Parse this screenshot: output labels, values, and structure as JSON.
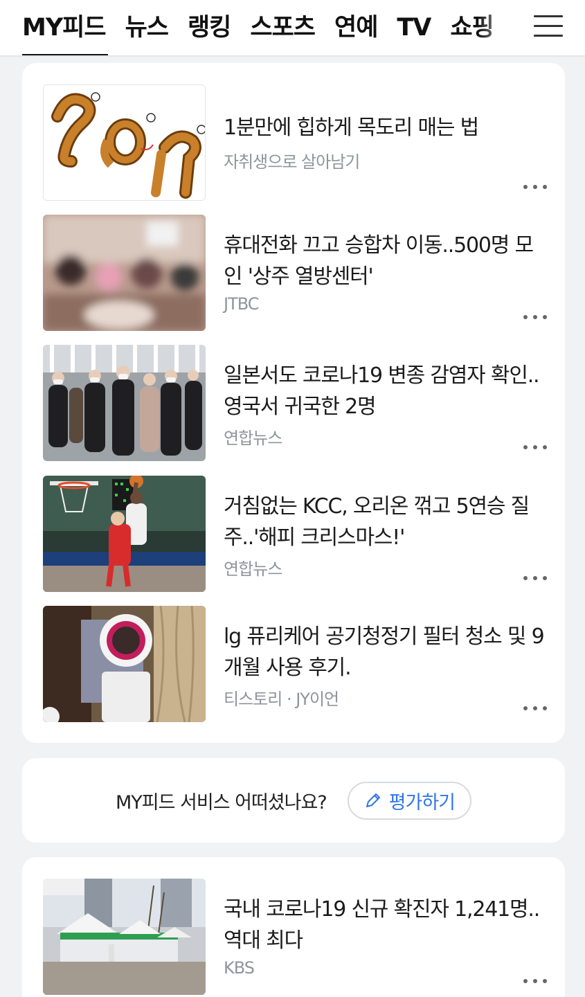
{
  "nav": {
    "tabs": [
      "MY피드",
      "뉴스",
      "랭킹",
      "스포츠",
      "연예",
      "TV",
      "쇼핑"
    ],
    "active_tab": "MY피드",
    "menu_icon": "hamburger-menu-icon"
  },
  "feed": [
    {
      "title": "1분만에 힙하게 목도리 매는 법",
      "source": "자취생으로 살아남기",
      "thumb": "scarf-tying-illustration"
    },
    {
      "title": "휴대전화 끄고 승합차 이동..500명 모인 '상주 열방센터'",
      "source": "JTBC",
      "thumb": "blurred-crowd-photo"
    },
    {
      "title": "일본서도 코로나19 변종 감염자 확인..영국서 귀국한 2명",
      "source": "연합뉴스",
      "thumb": "masked-commuters-photo"
    },
    {
      "title": "거침없는 KCC, 오리온 꺾고 5연승 질주..'해피 크리스마스!'",
      "source": "연합뉴스",
      "thumb": "basketball-dunk-photo"
    },
    {
      "title": "lg 퓨리케어 공기청정기 필터 청소 및 9개월 사용 후기.",
      "source": "티스토리 · JY이언",
      "thumb": "air-purifier-photo"
    }
  ],
  "survey": {
    "question": "MY피드 서비스 어떠셨나요?",
    "button_label": "평가하기",
    "button_icon": "pencil-icon",
    "accent_color": "#2f76e6"
  },
  "feed2": [
    {
      "title": "국내 코로나19 신규 확진자 1,241명..역대 최다",
      "source": "KBS",
      "thumb": "testing-tent-photo"
    }
  ]
}
